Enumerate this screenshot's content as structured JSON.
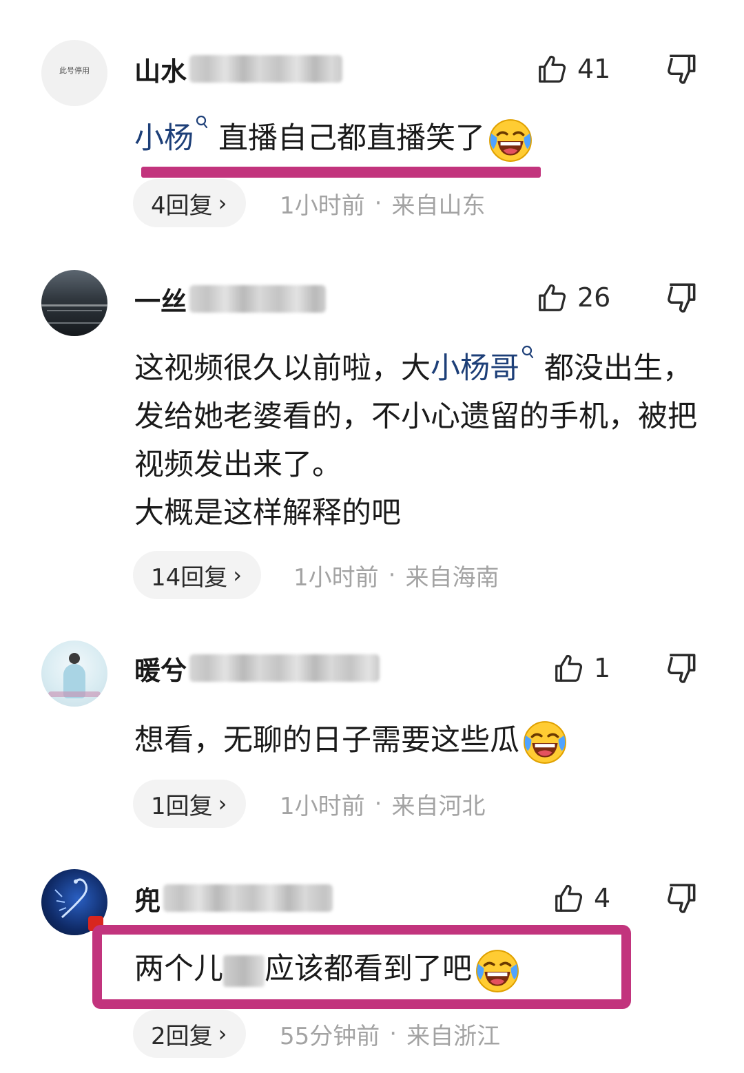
{
  "comments": [
    {
      "username_visible": "山水",
      "likes": "41",
      "body": {
        "mention": "小杨",
        "text": "直播自己都直播笑了"
      },
      "replies": "4回复",
      "time": "1小时前",
      "dot": "·",
      "location": "来自山东"
    },
    {
      "username_visible": "一丝",
      "likes": "26",
      "body": {
        "text_before": "这视频很久以前啦，大",
        "mention": "小杨哥",
        "text_after": "都没出生，发给她老婆看的，不小心遗留的手机，被把视频发出来了。",
        "line4": "大概是这样解释的吧"
      },
      "replies": "14回复",
      "time": "1小时前",
      "dot": "·",
      "location": "来自海南"
    },
    {
      "username_visible": "暖兮",
      "likes": "1",
      "body": {
        "text": "想看，无聊的日子需要这些瓜"
      },
      "replies": "1回复",
      "time": "1小时前",
      "dot": "·",
      "location": "来自河北"
    },
    {
      "username_visible": "兜",
      "likes": "4",
      "body": {
        "text_before": "两个儿",
        "text_after": "应该都看到了吧"
      },
      "replies": "2回复",
      "time": "55分钟前",
      "dot": "·",
      "location": "来自浙江"
    }
  ],
  "avatar1_text": "此号停用",
  "icons": {
    "like": "thumbs-up-icon",
    "dislike": "thumbs-down-icon",
    "emoji": "laughing-crying-emoji",
    "mention": "search-icon"
  },
  "colors": {
    "mention": "#1d3f78",
    "highlight": "#c2347d",
    "meta": "#a3a3a3"
  }
}
